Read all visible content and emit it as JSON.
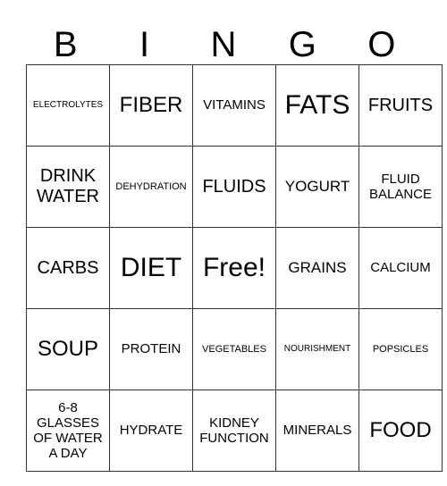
{
  "header": {
    "letters": [
      "B",
      "I",
      "N",
      "G",
      "O"
    ]
  },
  "grid": {
    "rows": [
      [
        "ELECTROLYTES",
        "FIBER",
        "VITAMINS",
        "FATS",
        "FRUITS"
      ],
      [
        "DRINK WATER",
        "DEHYDRATION",
        "FLUIDS",
        "YOGURT",
        "FLUID BALANCE"
      ],
      [
        "CARBS",
        "DIET",
        "Free!",
        "GRAINS",
        "CALCIUM"
      ],
      [
        "SOUP",
        "PROTEIN",
        "VEGETABLES",
        "NOURISHMENT",
        "POPSICLES"
      ],
      [
        "6-8 GLASSES OF WATER A DAY",
        "HYDRATE",
        "KIDNEY FUNCTION",
        "MINERALS",
        "FOOD"
      ]
    ]
  }
}
